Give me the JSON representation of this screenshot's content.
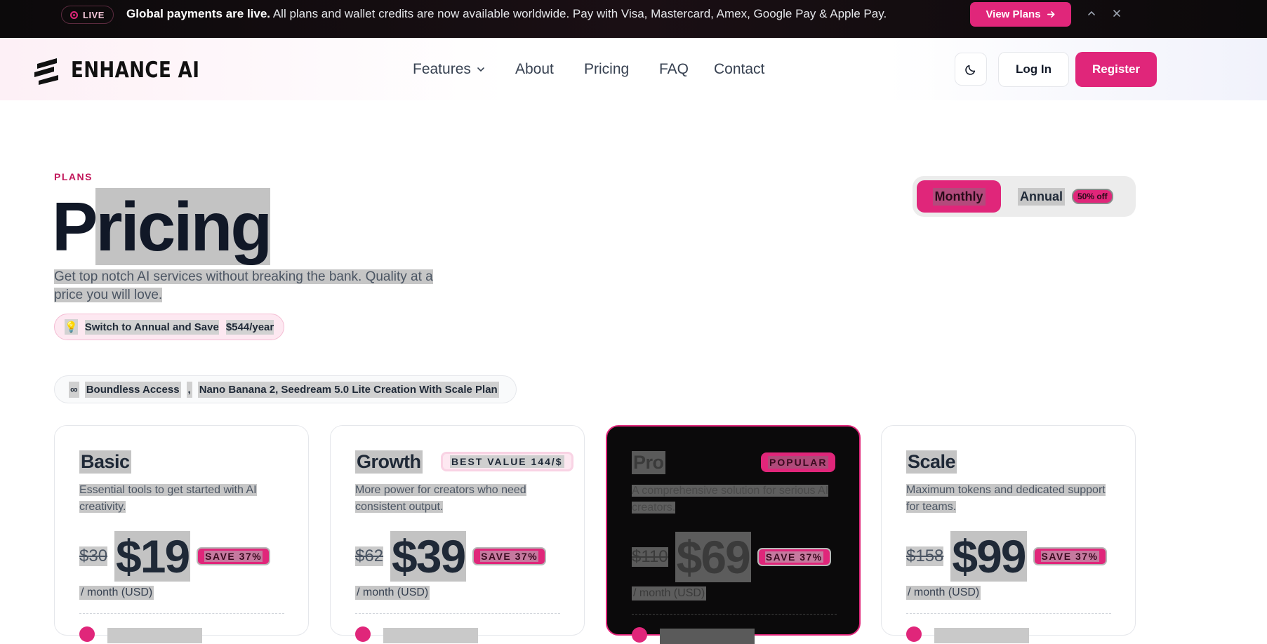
{
  "announcement": {
    "live_label": "LIVE",
    "headline": "Global payments are live.",
    "message": "All plans and wallet credits are now available worldwide. Pay with Visa, Mastercard, Amex, Google Pay & Apple Pay.",
    "cta_label": "View Plans",
    "accent_color": "#e0267a"
  },
  "header": {
    "brand": "ENHANCE AI",
    "nav": [
      {
        "label": "Features",
        "has_dropdown": true
      },
      {
        "label": "About"
      },
      {
        "label": "Pricing"
      },
      {
        "label": "FAQ"
      },
      {
        "label": "Contact"
      }
    ],
    "login_label": "Log In",
    "register_label": "Register"
  },
  "hero": {
    "eyebrow": "PLANS",
    "title_first": "P",
    "title_rest": "ricing",
    "subtitle": "Get top notch AI services without breaking the bank. Quality at a price you will love.",
    "save_pill_icon": "💡",
    "save_pill_text": "Switch to Annual and Save",
    "save_pill_amount": "$544/year"
  },
  "billing_toggle": {
    "monthly_label": "Monthly",
    "annual_label": "Annual",
    "annual_badge": "50% off",
    "selected": "Monthly"
  },
  "access_pill": {
    "icon": "∞",
    "label": "Boundless Access",
    "separator": ",",
    "detail": "Nano Banana 2, Seedream 5.0 Lite Creation With Scale Plan"
  },
  "plans": [
    {
      "name": "Basic",
      "badge": "",
      "description": "Essential tools to get started with AI creativity.",
      "old_price": "$30",
      "price": "$19",
      "save": "SAVE 37%",
      "period": "/ month (USD)"
    },
    {
      "name": "Growth",
      "badge": "BEST VALUE 144/$",
      "description": "More power for creators who need consistent output.",
      "old_price": "$62",
      "price": "$39",
      "save": "SAVE 37%",
      "period": "/ month (USD)"
    },
    {
      "name": "Pro",
      "badge": "POPULAR",
      "description": "A comprehensive solution for serious AI creators.",
      "old_price": "$110",
      "price": "$69",
      "save": "SAVE 37%",
      "period": "/ month (USD)"
    },
    {
      "name": "Scale",
      "badge": "",
      "description": "Maximum tokens and dedicated support for teams.",
      "old_price": "$158",
      "price": "$99",
      "save": "SAVE 37%",
      "period": "/ month (USD)"
    }
  ]
}
